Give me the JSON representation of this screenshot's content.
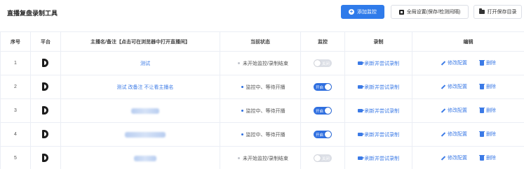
{
  "app": {
    "title": "直播复盘录制工具"
  },
  "toolbar": {
    "add_label": "添加监控",
    "settings_label": "全局设置(保存/检测间隔)",
    "open_label": "打开保存目录"
  },
  "table": {
    "headers": {
      "index": "序号",
      "platform": "平台",
      "name": "主播名/备注【点击可在浏览器中打开直播间】",
      "status": "当前状态",
      "monitor": "监控",
      "record": "录制",
      "edit": "编辑"
    },
    "rows": [
      {
        "index": "1",
        "name": "测试",
        "blur_width": 0,
        "status": "未开始监控/录制结束",
        "status_color": "#c0c4cc",
        "monitor_on": false,
        "toggle_label": "关闭"
      },
      {
        "index": "2",
        "name": "测试 改备注 不让看主播名",
        "blur_width": 0,
        "status": "监控中、等待开播",
        "status_color": "#2f6fe0",
        "monitor_on": true,
        "toggle_label": "开启"
      },
      {
        "index": "3",
        "name": "",
        "blur_width": 40,
        "status": "监控中、等待开播",
        "status_color": "#2f6fe0",
        "monitor_on": true,
        "toggle_label": "开启"
      },
      {
        "index": "4",
        "name": "",
        "blur_width": 58,
        "status": "监控中、等待开播",
        "status_color": "#2f6fe0",
        "monitor_on": true,
        "toggle_label": "开启"
      },
      {
        "index": "5",
        "name": "",
        "blur_width": 32,
        "status": "未开始监控/录制结束",
        "status_color": "#c0c4cc",
        "monitor_on": false,
        "toggle_label": "关闭"
      }
    ],
    "record_label": "刷新并尝试录制",
    "edit_label": "修改配置",
    "delete_label": "删除"
  },
  "icons": {
    "add": "plus-circle-icon",
    "settings": "settings-square-icon",
    "open": "folder-icon",
    "platform": "douyin-logo-icon",
    "record": "video-camera-icon",
    "edit": "pencil-icon",
    "delete": "trash-icon"
  },
  "colors": {
    "accent": "#2f7bea",
    "link": "#3b7ae6",
    "toggle_on": "#2f6fe0",
    "toggle_off": "#dcdfe6"
  }
}
